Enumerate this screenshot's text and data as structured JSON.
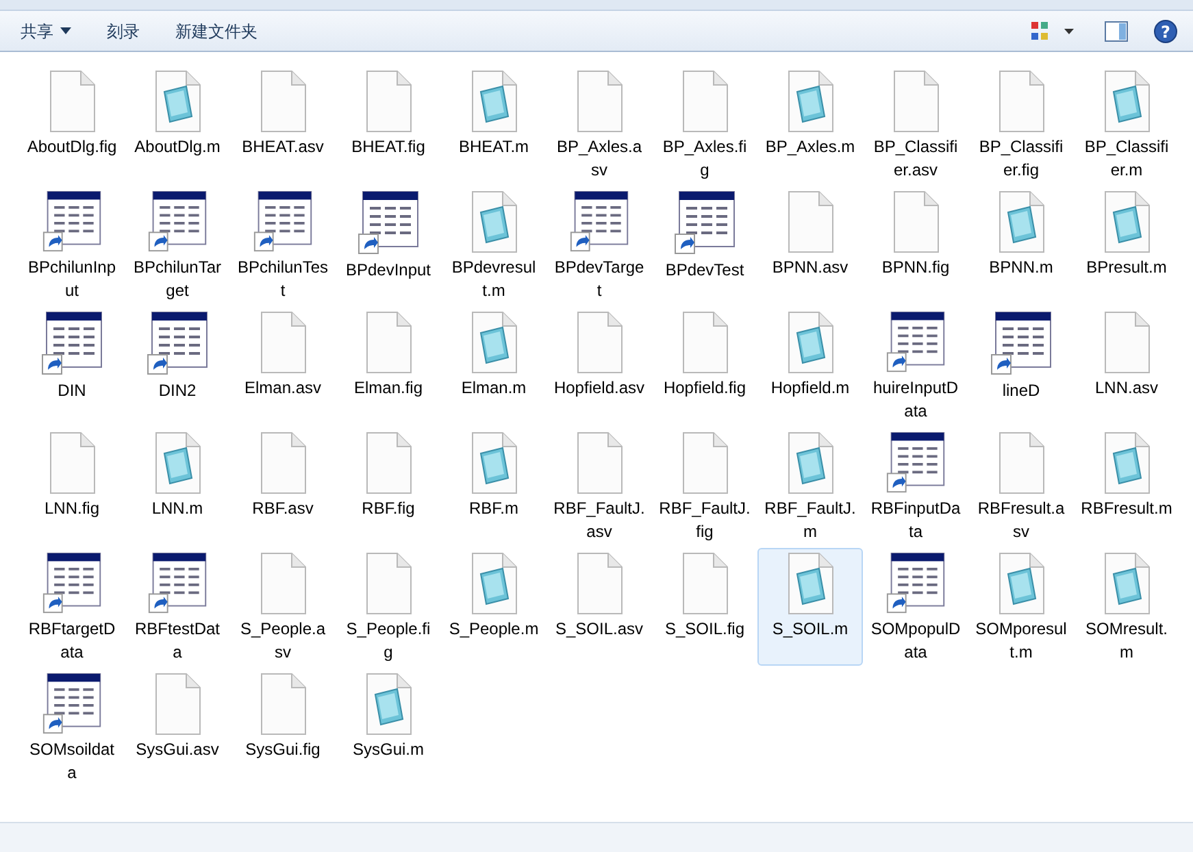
{
  "toolbar": {
    "help_label": "?",
    "buttons": [
      {
        "label": "共享",
        "has_menu": true
      },
      {
        "label": "刻录",
        "has_menu": false
      },
      {
        "label": "新建文件夹",
        "has_menu": false
      }
    ]
  },
  "files": [
    {
      "name": "AboutDlg.fig",
      "kind": "blank",
      "selected": false
    },
    {
      "name": "AboutDlg.m",
      "kind": "mfile",
      "selected": false
    },
    {
      "name": "BHEAT.asv",
      "kind": "blank",
      "selected": false
    },
    {
      "name": "BHEAT.fig",
      "kind": "blank",
      "selected": false
    },
    {
      "name": "BHEAT.m",
      "kind": "mfile",
      "selected": false
    },
    {
      "name": "BP_Axles.asv",
      "kind": "blank",
      "selected": false
    },
    {
      "name": "BP_Axles.fig",
      "kind": "blank",
      "selected": false
    },
    {
      "name": "BP_Axles.m",
      "kind": "mfile",
      "selected": false
    },
    {
      "name": "BP_Classifier.asv",
      "kind": "blank",
      "selected": false
    },
    {
      "name": "BP_Classifier.fig",
      "kind": "blank",
      "selected": false
    },
    {
      "name": "BP_Classifier.m",
      "kind": "mfile",
      "selected": false
    },
    {
      "name": "BPchilunInput",
      "kind": "shortcut",
      "selected": false
    },
    {
      "name": "BPchilunTarget",
      "kind": "shortcut",
      "selected": false
    },
    {
      "name": "BPchilunTest",
      "kind": "shortcut",
      "selected": false
    },
    {
      "name": "BPdevInput",
      "kind": "shortcut",
      "selected": false
    },
    {
      "name": "BPdevresult.m",
      "kind": "mfile",
      "selected": false
    },
    {
      "name": "BPdevTarget",
      "kind": "shortcut",
      "selected": false
    },
    {
      "name": "BPdevTest",
      "kind": "shortcut",
      "selected": false
    },
    {
      "name": "BPNN.asv",
      "kind": "blank",
      "selected": false
    },
    {
      "name": "BPNN.fig",
      "kind": "blank",
      "selected": false
    },
    {
      "name": "BPNN.m",
      "kind": "mfile",
      "selected": false
    },
    {
      "name": "BPresult.m",
      "kind": "mfile",
      "selected": false
    },
    {
      "name": "DIN",
      "kind": "shortcut",
      "selected": false
    },
    {
      "name": "DIN2",
      "kind": "shortcut",
      "selected": false
    },
    {
      "name": "Elman.asv",
      "kind": "blank",
      "selected": false
    },
    {
      "name": "Elman.fig",
      "kind": "blank",
      "selected": false
    },
    {
      "name": "Elman.m",
      "kind": "mfile",
      "selected": false
    },
    {
      "name": "Hopfield.asv",
      "kind": "blank",
      "selected": false
    },
    {
      "name": "Hopfield.fig",
      "kind": "blank",
      "selected": false
    },
    {
      "name": "Hopfield.m",
      "kind": "mfile",
      "selected": false
    },
    {
      "name": "huireInputData",
      "kind": "shortcut",
      "selected": false
    },
    {
      "name": "lineD",
      "kind": "shortcut",
      "selected": false
    },
    {
      "name": "LNN.asv",
      "kind": "blank",
      "selected": false
    },
    {
      "name": "LNN.fig",
      "kind": "blank",
      "selected": false
    },
    {
      "name": "LNN.m",
      "kind": "mfile",
      "selected": false
    },
    {
      "name": "RBF.asv",
      "kind": "blank",
      "selected": false
    },
    {
      "name": "RBF.fig",
      "kind": "blank",
      "selected": false
    },
    {
      "name": "RBF.m",
      "kind": "mfile",
      "selected": false
    },
    {
      "name": "RBF_FaultJ.asv",
      "kind": "blank",
      "selected": false
    },
    {
      "name": "RBF_FaultJ.fig",
      "kind": "blank",
      "selected": false
    },
    {
      "name": "RBF_FaultJ.m",
      "kind": "mfile",
      "selected": false
    },
    {
      "name": "RBFinputData",
      "kind": "shortcut",
      "selected": false
    },
    {
      "name": "RBFresult.asv",
      "kind": "blank",
      "selected": false
    },
    {
      "name": "RBFresult.m",
      "kind": "mfile",
      "selected": false
    },
    {
      "name": "RBFtargetData",
      "kind": "shortcut",
      "selected": false
    },
    {
      "name": "RBFtestData",
      "kind": "shortcut",
      "selected": false
    },
    {
      "name": "S_People.asv",
      "kind": "blank",
      "selected": false
    },
    {
      "name": "S_People.fig",
      "kind": "blank",
      "selected": false
    },
    {
      "name": "S_People.m",
      "kind": "mfile",
      "selected": false
    },
    {
      "name": "S_SOIL.asv",
      "kind": "blank",
      "selected": false
    },
    {
      "name": "S_SOIL.fig",
      "kind": "blank",
      "selected": false
    },
    {
      "name": "S_SOIL.m",
      "kind": "mfile",
      "selected": true
    },
    {
      "name": "SOMpopulData",
      "kind": "shortcut",
      "selected": false
    },
    {
      "name": "SOMporesult.m",
      "kind": "mfile",
      "selected": false
    },
    {
      "name": "SOMresult.m",
      "kind": "mfile",
      "selected": false
    },
    {
      "name": "SOMsoildata",
      "kind": "shortcut",
      "selected": false
    },
    {
      "name": "SysGui.asv",
      "kind": "blank",
      "selected": false
    },
    {
      "name": "SysGui.fig",
      "kind": "blank",
      "selected": false
    },
    {
      "name": "SysGui.m",
      "kind": "mfile",
      "selected": false
    }
  ]
}
